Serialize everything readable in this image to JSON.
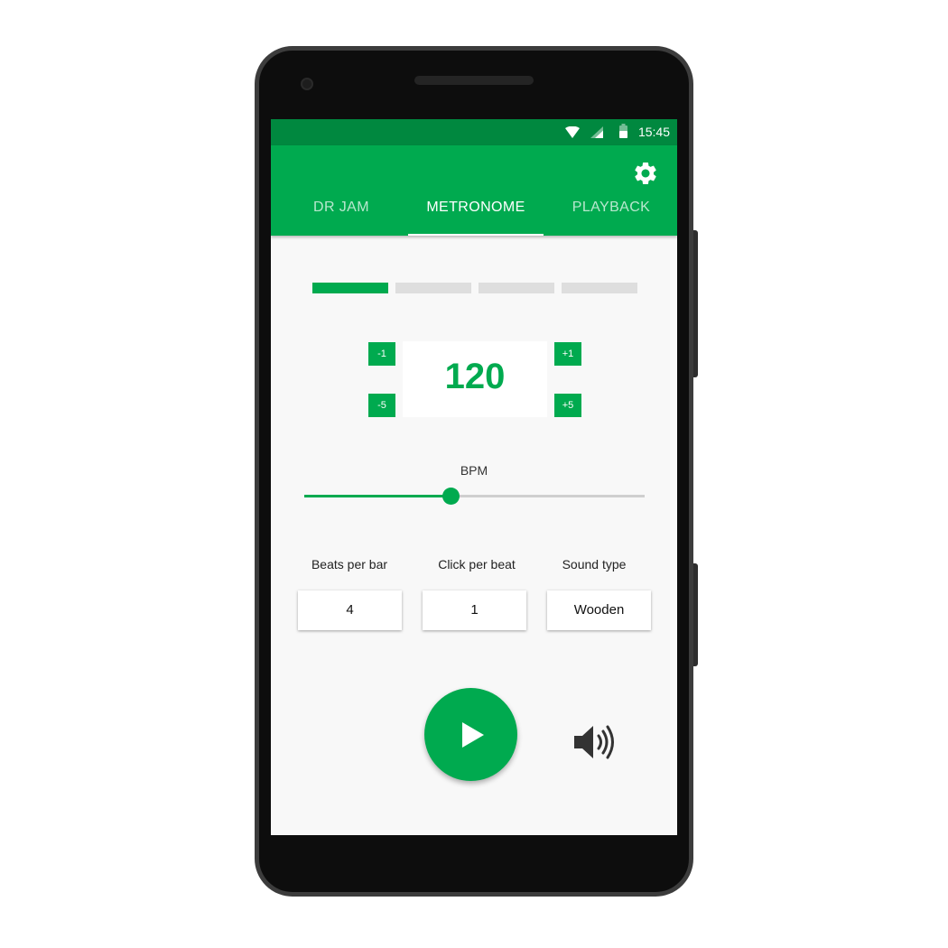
{
  "status_bar": {
    "time": "15:45",
    "icons": [
      "wifi-icon",
      "signal-icon",
      "battery-icon"
    ]
  },
  "header": {
    "settings_icon": "gear-icon",
    "tabs": [
      {
        "label": "DR JAM",
        "active": false
      },
      {
        "label": "METRONOME",
        "active": true
      },
      {
        "label": "PLAYBACK",
        "active": false
      }
    ]
  },
  "metronome": {
    "beats_indicator": {
      "total": 4,
      "current": 1
    },
    "bpm": {
      "value": "120",
      "minus_1": "-1",
      "minus_5": "-5",
      "plus_1": "+1",
      "plus_5": "+5",
      "label": "BPM",
      "slider_fraction": 0.43
    },
    "options": {
      "beats_per_bar": {
        "label": "Beats per bar",
        "value": "4"
      },
      "click_per_beat": {
        "label": "Click per beat",
        "value": "1"
      },
      "sound_type": {
        "label": "Sound type",
        "value": "Wooden"
      }
    },
    "controls": {
      "play_icon": "play-icon",
      "volume_icon": "volume-icon"
    }
  },
  "colors": {
    "accent": "#00aa4f",
    "status_bar": "#00883f",
    "background": "#f8f8f8"
  }
}
